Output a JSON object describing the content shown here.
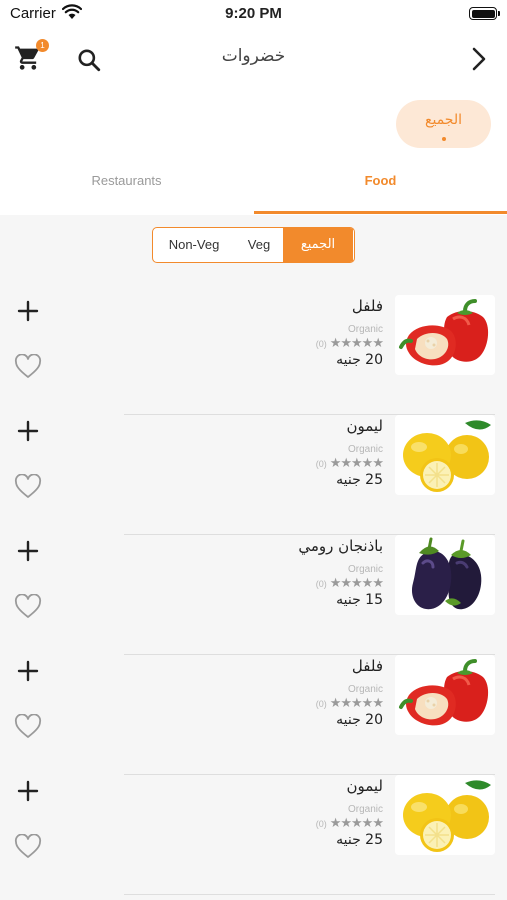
{
  "status_bar": {
    "carrier": "Carrier",
    "time": "9:20 PM"
  },
  "nav": {
    "title": "خضروات",
    "cart_badge": "1"
  },
  "category_chip": {
    "label": "الجميع"
  },
  "tabs": [
    {
      "label": "Restaurants",
      "selected": false
    },
    {
      "label": "Food",
      "selected": true
    }
  ],
  "filter": {
    "options": [
      "Non-Veg",
      "Veg",
      "الجميع"
    ],
    "selected": "الجميع"
  },
  "colors": {
    "accent": "#f28a2c",
    "chip_bg": "#fde8d6",
    "list_bg": "#f6f6f6"
  },
  "products": [
    {
      "name": "فلفل",
      "subtitle": "Organic",
      "stars": "★★★★★",
      "rating_count": "(0)",
      "price": "20 جنيه",
      "image": "pepper"
    },
    {
      "name": "ليمون",
      "subtitle": "Organic",
      "stars": "★★★★★",
      "rating_count": "(0)",
      "price": "25 جنيه",
      "image": "lemon"
    },
    {
      "name": "باذنجان رومي",
      "subtitle": "Organic",
      "stars": "★★★★★",
      "rating_count": "(0)",
      "price": "15 جنيه",
      "image": "eggplant"
    },
    {
      "name": "فلفل",
      "subtitle": "Organic",
      "stars": "★★★★★",
      "rating_count": "(0)",
      "price": "20 جنيه",
      "image": "pepper"
    },
    {
      "name": "ليمون",
      "subtitle": "Organic",
      "stars": "★★★★★",
      "rating_count": "(0)",
      "price": "25 جنيه",
      "image": "lemon"
    }
  ]
}
